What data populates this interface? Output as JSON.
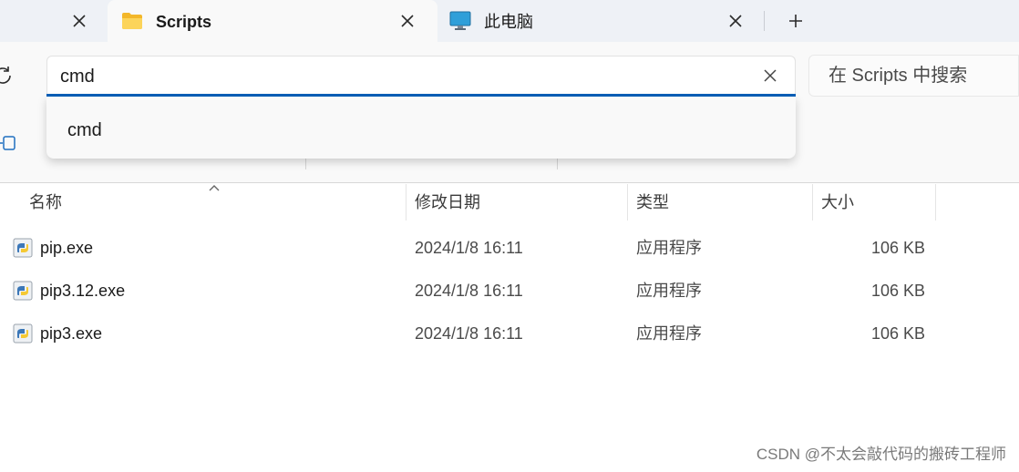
{
  "tabs": [
    {
      "title": "",
      "close_icon": "close-icon"
    },
    {
      "title": "Scripts",
      "icon": "folder-icon",
      "close_icon": "close-icon",
      "active": true
    },
    {
      "title": "此电脑",
      "icon": "monitor-icon",
      "close_icon": "close-icon"
    }
  ],
  "address": {
    "value": "cmd"
  },
  "search": {
    "placeholder": "在 Scripts 中搜索"
  },
  "dropdown": {
    "suggestion": "cmd"
  },
  "columns": {
    "name": "名称",
    "date": "修改日期",
    "type": "类型",
    "size": "大小"
  },
  "files": [
    {
      "name": "pip.exe",
      "date": "2024/1/8 16:11",
      "type": "应用程序",
      "size": "106 KB"
    },
    {
      "name": "pip3.12.exe",
      "date": "2024/1/8 16:11",
      "type": "应用程序",
      "size": "106 KB"
    },
    {
      "name": "pip3.exe",
      "date": "2024/1/8 16:11",
      "type": "应用程序",
      "size": "106 KB"
    }
  ],
  "watermark": "CSDN @不太会敲代码的搬砖工程师",
  "colors": {
    "accent": "#005fb8",
    "folder": "#f8c43d",
    "monitor": "#2f9fd9"
  }
}
